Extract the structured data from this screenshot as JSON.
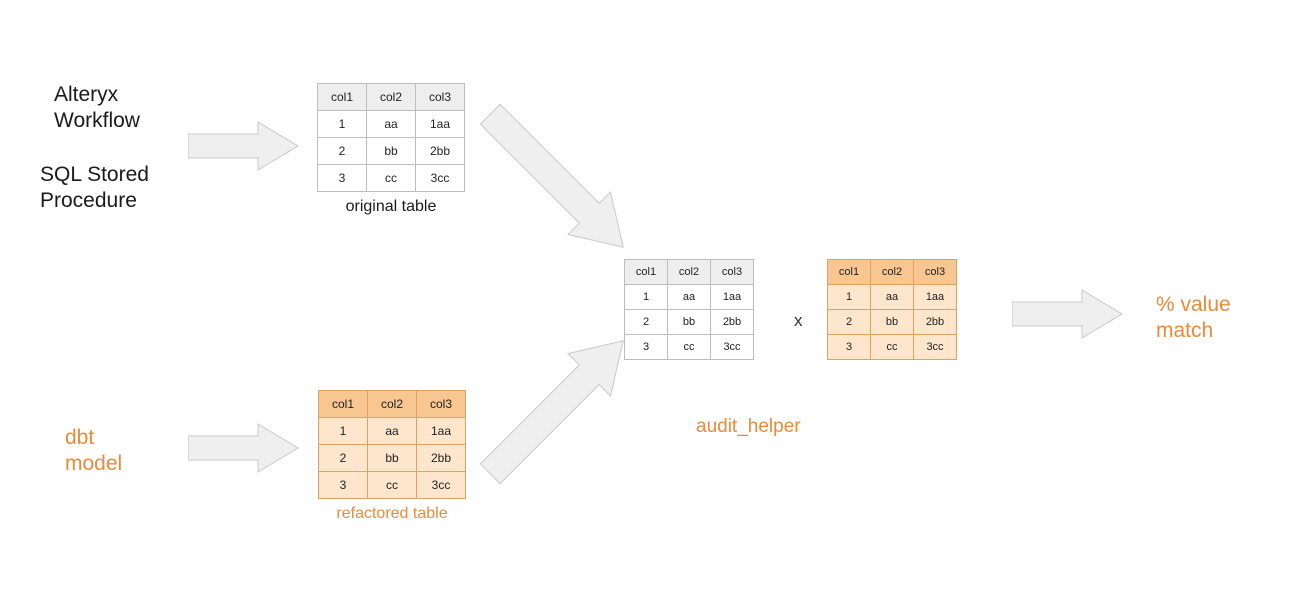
{
  "labels": {
    "alteryx": "Alteryx\nWorkflow",
    "sqlproc": "SQL Stored\nProcedure",
    "dbt": "dbt\nmodel",
    "original_caption": "original table",
    "refactored_caption": "refactored table",
    "audit_helper": "audit_helper",
    "result": "% value\nmatch",
    "x": "x"
  },
  "table": {
    "headers": [
      "col1",
      "col2",
      "col3"
    ],
    "rows": [
      [
        "1",
        "aa",
        "1aa"
      ],
      [
        "2",
        "bb",
        "2bb"
      ],
      [
        "3",
        "cc",
        "3cc"
      ]
    ]
  },
  "arrow_fill": "#efefef",
  "arrow_stroke": "#c8c8c8"
}
